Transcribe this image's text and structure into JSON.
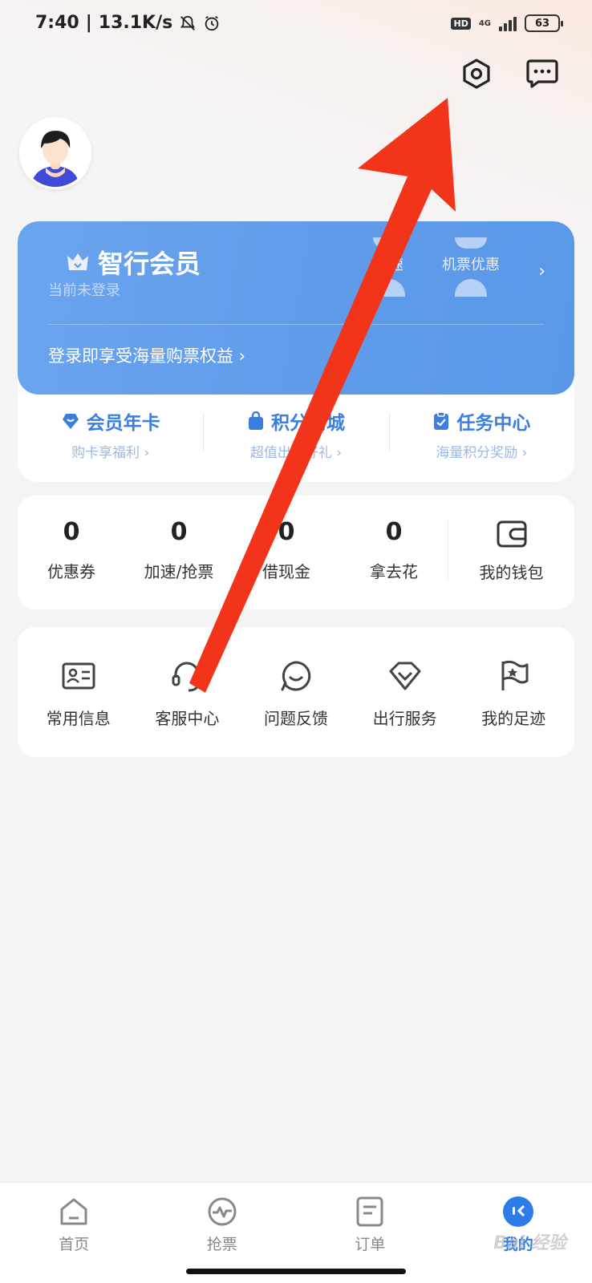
{
  "status_bar": {
    "time": "7:40",
    "speed": "13.1K/s",
    "hd": "HD",
    "network": "4G",
    "battery": "63"
  },
  "member": {
    "title": "智行会员",
    "subtitle": "当前未登录",
    "benefits": [
      "提速",
      "机票优惠"
    ],
    "login_prompt": "登录即享受海量购票权益 ›"
  },
  "quick_links": [
    {
      "title": "会员年卡",
      "sub": "购卡享福利 ›"
    },
    {
      "title": "积分商城",
      "sub": "超值出行好礼 ›"
    },
    {
      "title": "任务中心",
      "sub": "海量积分奖励 ›"
    }
  ],
  "wallet": {
    "stats": [
      {
        "value": "0",
        "label": "优惠券"
      },
      {
        "value": "0",
        "label": "加速/抢票"
      },
      {
        "value": "0",
        "label": "借现金"
      },
      {
        "value": "0",
        "label": "拿去花"
      }
    ],
    "wallet_label": "我的钱包"
  },
  "services": [
    {
      "label": "常用信息",
      "icon": "id-card-icon"
    },
    {
      "label": "客服中心",
      "icon": "headset-icon"
    },
    {
      "label": "问题反馈",
      "icon": "feedback-icon"
    },
    {
      "label": "出行服务",
      "icon": "diamond-icon"
    },
    {
      "label": "我的足迹",
      "icon": "flag-icon"
    }
  ],
  "nav": [
    {
      "label": "首页",
      "icon": "home-icon"
    },
    {
      "label": "抢票",
      "icon": "pulse-icon"
    },
    {
      "label": "订单",
      "icon": "order-icon"
    },
    {
      "label": "我的",
      "icon": "profile-icon",
      "active": true
    }
  ],
  "watermark": "Bai 经验",
  "colors": {
    "accent": "#2e7bea",
    "member_card": "#5f9bea",
    "arrow": "#f2351a"
  }
}
